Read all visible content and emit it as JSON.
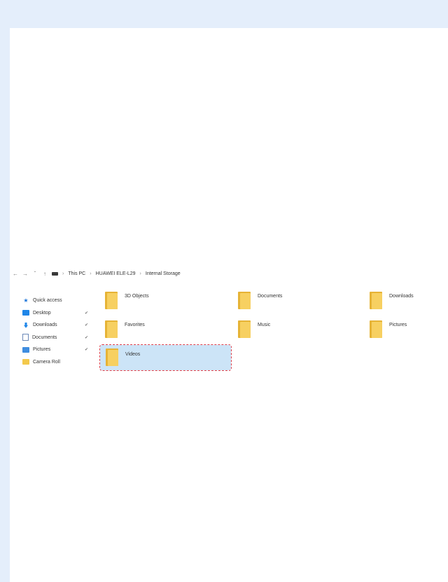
{
  "address": {
    "crumbs": [
      "This PC",
      "HUAWEI ELE-L29",
      "Internal Storage"
    ]
  },
  "sidebar": {
    "items": [
      {
        "label": "Quick access",
        "icon": "star-icon",
        "pinned": false
      },
      {
        "label": "Desktop",
        "icon": "desktop-icon",
        "pinned": true
      },
      {
        "label": "Downloads",
        "icon": "download-icon",
        "pinned": true
      },
      {
        "label": "Documents",
        "icon": "document-icon",
        "pinned": true
      },
      {
        "label": "Pictures",
        "icon": "pictures-icon",
        "pinned": true
      },
      {
        "label": "Camera Roll",
        "icon": "folder-icon",
        "pinned": false
      }
    ]
  },
  "folders": [
    {
      "label": "3D Objects"
    },
    {
      "label": "Documents"
    },
    {
      "label": "Downloads"
    },
    {
      "label": "Favorites"
    },
    {
      "label": "Music"
    },
    {
      "label": "Pictures"
    },
    {
      "label": "Videos",
      "selected": true
    }
  ],
  "colors": {
    "page_background": "#e4eefb",
    "folder_yellow": "#f7d061",
    "selection": "#cce4f7",
    "selection_outline": "#e0404a",
    "accent_blue": "#1f86e8"
  }
}
